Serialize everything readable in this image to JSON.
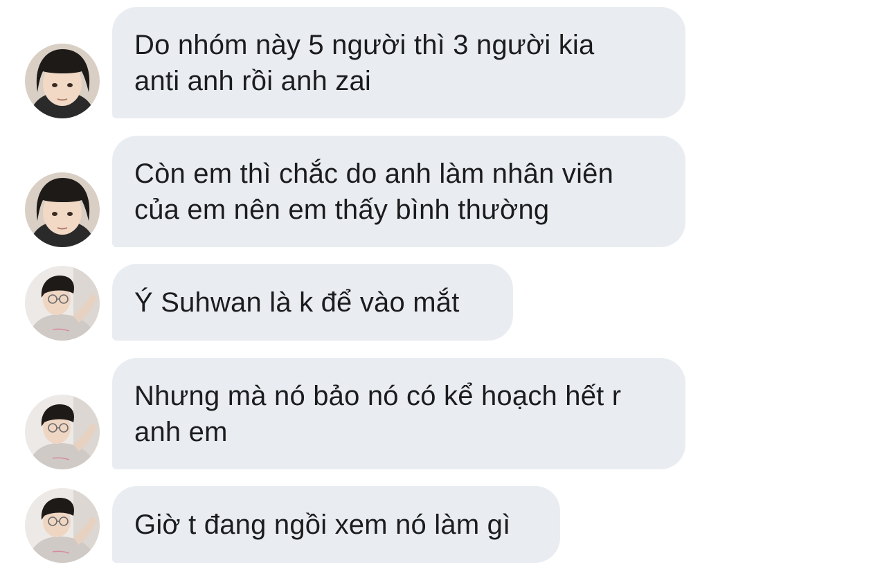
{
  "messages": [
    {
      "avatar": "girl-avatar",
      "text": "Do nhóm này 5 người thì 3 người kia\nanti anh rồi anh zai"
    },
    {
      "avatar": "girl-avatar",
      "text": "Còn em thì chắc do anh làm nhân viên\ncủa em nên em thấy bình thường"
    },
    {
      "avatar": "boy-avatar",
      "text": "Ý Suhwan là k để vào mắt"
    },
    {
      "avatar": "boy-avatar",
      "text": "Nhưng mà nó bảo nó có kể hoạch hết r\nanh em"
    },
    {
      "avatar": "boy-avatar",
      "text": "Giờ t đang ngồi xem nó làm gì"
    }
  ],
  "colors": {
    "bubble_bg": "#e9edf1",
    "text": "#1c1c1e",
    "background": "#ffffff"
  }
}
